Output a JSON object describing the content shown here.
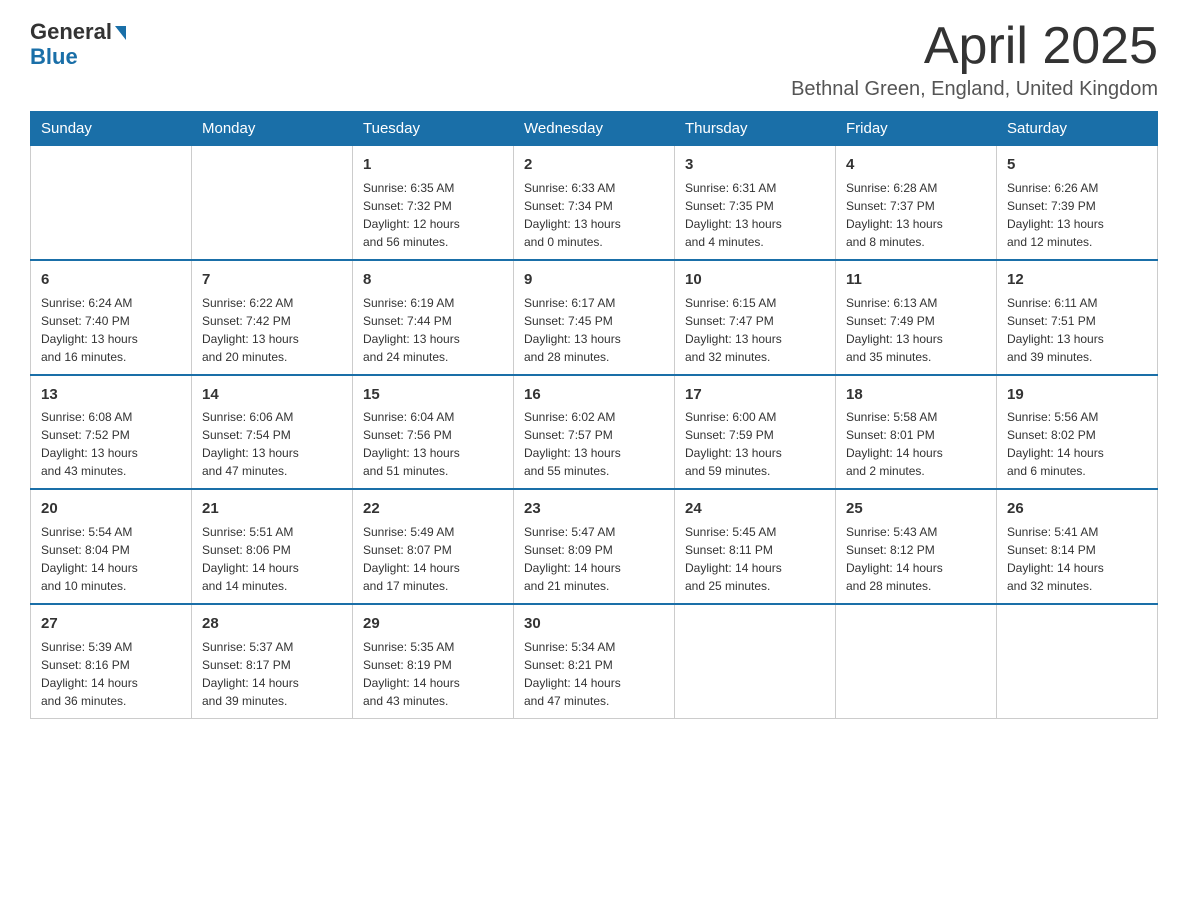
{
  "header": {
    "logo_line1": "General",
    "logo_line2": "Blue",
    "month": "April 2025",
    "location": "Bethnal Green, England, United Kingdom"
  },
  "days_of_week": [
    "Sunday",
    "Monday",
    "Tuesday",
    "Wednesday",
    "Thursday",
    "Friday",
    "Saturday"
  ],
  "weeks": [
    [
      {
        "day": "",
        "info": ""
      },
      {
        "day": "",
        "info": ""
      },
      {
        "day": "1",
        "info": "Sunrise: 6:35 AM\nSunset: 7:32 PM\nDaylight: 12 hours\nand 56 minutes."
      },
      {
        "day": "2",
        "info": "Sunrise: 6:33 AM\nSunset: 7:34 PM\nDaylight: 13 hours\nand 0 minutes."
      },
      {
        "day": "3",
        "info": "Sunrise: 6:31 AM\nSunset: 7:35 PM\nDaylight: 13 hours\nand 4 minutes."
      },
      {
        "day": "4",
        "info": "Sunrise: 6:28 AM\nSunset: 7:37 PM\nDaylight: 13 hours\nand 8 minutes."
      },
      {
        "day": "5",
        "info": "Sunrise: 6:26 AM\nSunset: 7:39 PM\nDaylight: 13 hours\nand 12 minutes."
      }
    ],
    [
      {
        "day": "6",
        "info": "Sunrise: 6:24 AM\nSunset: 7:40 PM\nDaylight: 13 hours\nand 16 minutes."
      },
      {
        "day": "7",
        "info": "Sunrise: 6:22 AM\nSunset: 7:42 PM\nDaylight: 13 hours\nand 20 minutes."
      },
      {
        "day": "8",
        "info": "Sunrise: 6:19 AM\nSunset: 7:44 PM\nDaylight: 13 hours\nand 24 minutes."
      },
      {
        "day": "9",
        "info": "Sunrise: 6:17 AM\nSunset: 7:45 PM\nDaylight: 13 hours\nand 28 minutes."
      },
      {
        "day": "10",
        "info": "Sunrise: 6:15 AM\nSunset: 7:47 PM\nDaylight: 13 hours\nand 32 minutes."
      },
      {
        "day": "11",
        "info": "Sunrise: 6:13 AM\nSunset: 7:49 PM\nDaylight: 13 hours\nand 35 minutes."
      },
      {
        "day": "12",
        "info": "Sunrise: 6:11 AM\nSunset: 7:51 PM\nDaylight: 13 hours\nand 39 minutes."
      }
    ],
    [
      {
        "day": "13",
        "info": "Sunrise: 6:08 AM\nSunset: 7:52 PM\nDaylight: 13 hours\nand 43 minutes."
      },
      {
        "day": "14",
        "info": "Sunrise: 6:06 AM\nSunset: 7:54 PM\nDaylight: 13 hours\nand 47 minutes."
      },
      {
        "day": "15",
        "info": "Sunrise: 6:04 AM\nSunset: 7:56 PM\nDaylight: 13 hours\nand 51 minutes."
      },
      {
        "day": "16",
        "info": "Sunrise: 6:02 AM\nSunset: 7:57 PM\nDaylight: 13 hours\nand 55 minutes."
      },
      {
        "day": "17",
        "info": "Sunrise: 6:00 AM\nSunset: 7:59 PM\nDaylight: 13 hours\nand 59 minutes."
      },
      {
        "day": "18",
        "info": "Sunrise: 5:58 AM\nSunset: 8:01 PM\nDaylight: 14 hours\nand 2 minutes."
      },
      {
        "day": "19",
        "info": "Sunrise: 5:56 AM\nSunset: 8:02 PM\nDaylight: 14 hours\nand 6 minutes."
      }
    ],
    [
      {
        "day": "20",
        "info": "Sunrise: 5:54 AM\nSunset: 8:04 PM\nDaylight: 14 hours\nand 10 minutes."
      },
      {
        "day": "21",
        "info": "Sunrise: 5:51 AM\nSunset: 8:06 PM\nDaylight: 14 hours\nand 14 minutes."
      },
      {
        "day": "22",
        "info": "Sunrise: 5:49 AM\nSunset: 8:07 PM\nDaylight: 14 hours\nand 17 minutes."
      },
      {
        "day": "23",
        "info": "Sunrise: 5:47 AM\nSunset: 8:09 PM\nDaylight: 14 hours\nand 21 minutes."
      },
      {
        "day": "24",
        "info": "Sunrise: 5:45 AM\nSunset: 8:11 PM\nDaylight: 14 hours\nand 25 minutes."
      },
      {
        "day": "25",
        "info": "Sunrise: 5:43 AM\nSunset: 8:12 PM\nDaylight: 14 hours\nand 28 minutes."
      },
      {
        "day": "26",
        "info": "Sunrise: 5:41 AM\nSunset: 8:14 PM\nDaylight: 14 hours\nand 32 minutes."
      }
    ],
    [
      {
        "day": "27",
        "info": "Sunrise: 5:39 AM\nSunset: 8:16 PM\nDaylight: 14 hours\nand 36 minutes."
      },
      {
        "day": "28",
        "info": "Sunrise: 5:37 AM\nSunset: 8:17 PM\nDaylight: 14 hours\nand 39 minutes."
      },
      {
        "day": "29",
        "info": "Sunrise: 5:35 AM\nSunset: 8:19 PM\nDaylight: 14 hours\nand 43 minutes."
      },
      {
        "day": "30",
        "info": "Sunrise: 5:34 AM\nSunset: 8:21 PM\nDaylight: 14 hours\nand 47 minutes."
      },
      {
        "day": "",
        "info": ""
      },
      {
        "day": "",
        "info": ""
      },
      {
        "day": "",
        "info": ""
      }
    ]
  ]
}
